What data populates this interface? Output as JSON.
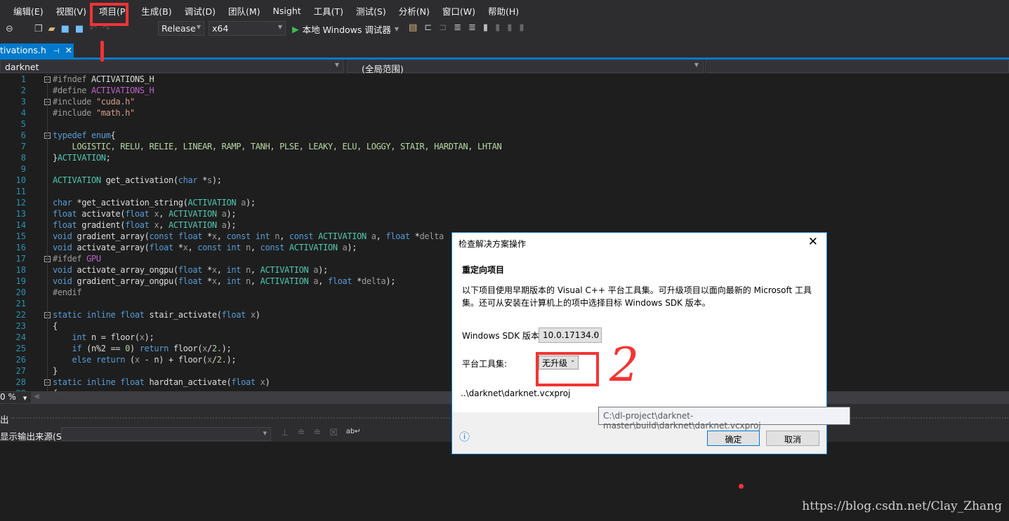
{
  "menu": [
    "编辑(E)",
    "视图(V)",
    "项目(P)",
    "生成(B)",
    "调试(D)",
    "团队(M)",
    "Nsight",
    "工具(T)",
    "测试(S)",
    "分析(N)",
    "窗口(W)",
    "帮助(H)"
  ],
  "toolbar": {
    "config": "Release",
    "platform": "x64",
    "debugger": "本地 Windows 调试器"
  },
  "tab": {
    "filename": "tivations.h",
    "pin": "⊣",
    "close": "✕"
  },
  "nav": {
    "project": "darknet",
    "scope": "(全局范围)"
  },
  "editor": {
    "zoom": "0 %",
    "lines": [
      [
        [
          "#ifndef ",
          "pp"
        ],
        [
          "ACTIVATIONS_H",
          "plain"
        ]
      ],
      [
        [
          "#define ",
          "pp"
        ],
        [
          "ACTIVATIONS_H",
          "macro"
        ]
      ],
      [
        [
          "#include ",
          "pp"
        ],
        [
          "\"cuda.h\"",
          "str"
        ]
      ],
      [
        [
          "#include ",
          "pp"
        ],
        [
          "\"math.h\"",
          "str"
        ]
      ],
      [],
      [
        [
          "typedef enum",
          "kw"
        ],
        [
          "{",
          "plain"
        ]
      ],
      [
        [
          "    LOGISTIC, RELU, RELIE, LINEAR, RAMP, TANH, PLSE, LEAKY, ELU, LOGGY, STAIR, HARDTAN, LHTAN",
          "enumv"
        ]
      ],
      [
        [
          "}",
          "plain"
        ],
        [
          "ACTIVATION",
          "type"
        ],
        [
          ";",
          "plain"
        ]
      ],
      [],
      [
        [
          "ACTIVATION",
          "type"
        ],
        [
          " get_activation(",
          "plain"
        ],
        [
          "char",
          "kw"
        ],
        [
          " *",
          "plain"
        ],
        [
          "s",
          "param"
        ],
        [
          ");",
          "plain"
        ]
      ],
      [],
      [
        [
          "char",
          "kw"
        ],
        [
          " *get_activation_string(",
          "plain"
        ],
        [
          "ACTIVATION",
          "type"
        ],
        [
          " ",
          "plain"
        ],
        [
          "a",
          "param"
        ],
        [
          ");",
          "plain"
        ]
      ],
      [
        [
          "float",
          "kw"
        ],
        [
          " activate(",
          "plain"
        ],
        [
          "float",
          "kw"
        ],
        [
          " ",
          "plain"
        ],
        [
          "x",
          "param"
        ],
        [
          ", ",
          "plain"
        ],
        [
          "ACTIVATION",
          "type"
        ],
        [
          " ",
          "plain"
        ],
        [
          "a",
          "param"
        ],
        [
          ");",
          "plain"
        ]
      ],
      [
        [
          "float",
          "kw"
        ],
        [
          " gradient(",
          "plain"
        ],
        [
          "float",
          "kw"
        ],
        [
          " ",
          "plain"
        ],
        [
          "x",
          "param"
        ],
        [
          ", ",
          "plain"
        ],
        [
          "ACTIVATION",
          "type"
        ],
        [
          " ",
          "plain"
        ],
        [
          "a",
          "param"
        ],
        [
          ");",
          "plain"
        ]
      ],
      [
        [
          "void",
          "kw"
        ],
        [
          " gradient_array(",
          "plain"
        ],
        [
          "const float",
          "kw"
        ],
        [
          " *",
          "plain"
        ],
        [
          "x",
          "param"
        ],
        [
          ", ",
          "plain"
        ],
        [
          "const int",
          "kw"
        ],
        [
          " ",
          "plain"
        ],
        [
          "n",
          "param"
        ],
        [
          ", ",
          "plain"
        ],
        [
          "const ",
          "kw"
        ],
        [
          "ACTIVATION",
          "type"
        ],
        [
          " ",
          "plain"
        ],
        [
          "a",
          "param"
        ],
        [
          ", ",
          "plain"
        ],
        [
          "float",
          "kw"
        ],
        [
          " *",
          "plain"
        ],
        [
          "delta",
          "param"
        ]
      ],
      [
        [
          "void",
          "kw"
        ],
        [
          " activate_array(",
          "plain"
        ],
        [
          "float",
          "kw"
        ],
        [
          " *",
          "plain"
        ],
        [
          "x",
          "param"
        ],
        [
          ", ",
          "plain"
        ],
        [
          "const int",
          "kw"
        ],
        [
          " ",
          "plain"
        ],
        [
          "n",
          "param"
        ],
        [
          ", ",
          "plain"
        ],
        [
          "const ",
          "kw"
        ],
        [
          "ACTIVATION",
          "type"
        ],
        [
          " ",
          "plain"
        ],
        [
          "a",
          "param"
        ],
        [
          ");",
          "plain"
        ]
      ],
      [
        [
          "#ifdef ",
          "pp"
        ],
        [
          "GPU",
          "macro"
        ]
      ],
      [
        [
          "void",
          "kw"
        ],
        [
          " activate_array_ongpu(",
          "plain"
        ],
        [
          "float",
          "kw"
        ],
        [
          " *",
          "plain"
        ],
        [
          "x",
          "param"
        ],
        [
          ", ",
          "plain"
        ],
        [
          "int",
          "kw"
        ],
        [
          " ",
          "plain"
        ],
        [
          "n",
          "param"
        ],
        [
          ", ",
          "plain"
        ],
        [
          "ACTIVATION",
          "type"
        ],
        [
          " ",
          "plain"
        ],
        [
          "a",
          "param"
        ],
        [
          ");",
          "plain"
        ]
      ],
      [
        [
          "void",
          "kw"
        ],
        [
          " gradient_array_ongpu(",
          "plain"
        ],
        [
          "float",
          "kw"
        ],
        [
          " *",
          "plain"
        ],
        [
          "x",
          "param"
        ],
        [
          ", ",
          "plain"
        ],
        [
          "int",
          "kw"
        ],
        [
          " ",
          "plain"
        ],
        [
          "n",
          "param"
        ],
        [
          ", ",
          "plain"
        ],
        [
          "ACTIVATION",
          "type"
        ],
        [
          " ",
          "plain"
        ],
        [
          "a",
          "param"
        ],
        [
          ", ",
          "plain"
        ],
        [
          "float",
          "kw"
        ],
        [
          " *",
          "plain"
        ],
        [
          "delta",
          "param"
        ],
        [
          ");",
          "plain"
        ]
      ],
      [
        [
          "#endif",
          "pp"
        ]
      ],
      [],
      [
        [
          "static inline float",
          "kw"
        ],
        [
          " stair_activate(",
          "plain"
        ],
        [
          "float",
          "kw"
        ],
        [
          " ",
          "plain"
        ],
        [
          "x",
          "param"
        ],
        [
          ")",
          "plain"
        ]
      ],
      [
        [
          "{",
          "plain"
        ]
      ],
      [
        [
          "    ",
          "plain"
        ],
        [
          "int",
          "kw"
        ],
        [
          " n = floor(",
          "plain"
        ],
        [
          "x",
          "param"
        ],
        [
          ");",
          "plain"
        ]
      ],
      [
        [
          "    ",
          "plain"
        ],
        [
          "if",
          "kw"
        ],
        [
          " (n%2 == ",
          "plain"
        ],
        [
          "0",
          "num"
        ],
        [
          ") ",
          "plain"
        ],
        [
          "return",
          "kw"
        ],
        [
          " floor(",
          "plain"
        ],
        [
          "x",
          "param"
        ],
        [
          "/",
          "plain"
        ],
        [
          "2.",
          "num"
        ],
        [
          ");",
          "plain"
        ]
      ],
      [
        [
          "    ",
          "plain"
        ],
        [
          "else return",
          "kw"
        ],
        [
          " (",
          "plain"
        ],
        [
          "x",
          "param"
        ],
        [
          " - n) + floor(",
          "plain"
        ],
        [
          "x",
          "param"
        ],
        [
          "/",
          "plain"
        ],
        [
          "2.",
          "num"
        ],
        [
          ");",
          "plain"
        ]
      ],
      [
        [
          "}",
          "plain"
        ]
      ],
      [
        [
          "static inline float",
          "kw"
        ],
        [
          " hardtan_activate(",
          "plain"
        ],
        [
          "float",
          "kw"
        ],
        [
          " ",
          "plain"
        ],
        [
          "x",
          "param"
        ],
        [
          ")",
          "plain"
        ]
      ],
      [
        [
          "{",
          "plain"
        ]
      ]
    ],
    "folds": [
      1,
      3,
      6,
      17,
      22,
      28
    ]
  },
  "output": {
    "title": "出",
    "source_label": "显示输出来源(S):",
    "source_value": ""
  },
  "dialog": {
    "title": "检查解决方案操作",
    "heading": "重定向项目",
    "description": "以下项目使用早期版本的 Visual C++ 平台工具集。可升级项目以面向最新的 Microsoft 工具集。还可从安装在计算机上的项中选择目标 Windows SDK 版本。",
    "sdk_label": "Windows SDK 版本:",
    "sdk_value": "10.0.17134.0",
    "toolset_label": "平台工具集:",
    "toolset_value": "无升级",
    "project_path": "..\\darknet\\darknet.vcxproj",
    "ok": "确定",
    "cancel": "取消"
  },
  "tooltip": "C:\\dl-project\\darknet-master\\build\\darknet\\darknet.vcxproj",
  "annotations": {
    "step2": "2",
    "color": "#f43333"
  },
  "watermark": "https://blog.csdn.net/Clay_Zhang"
}
